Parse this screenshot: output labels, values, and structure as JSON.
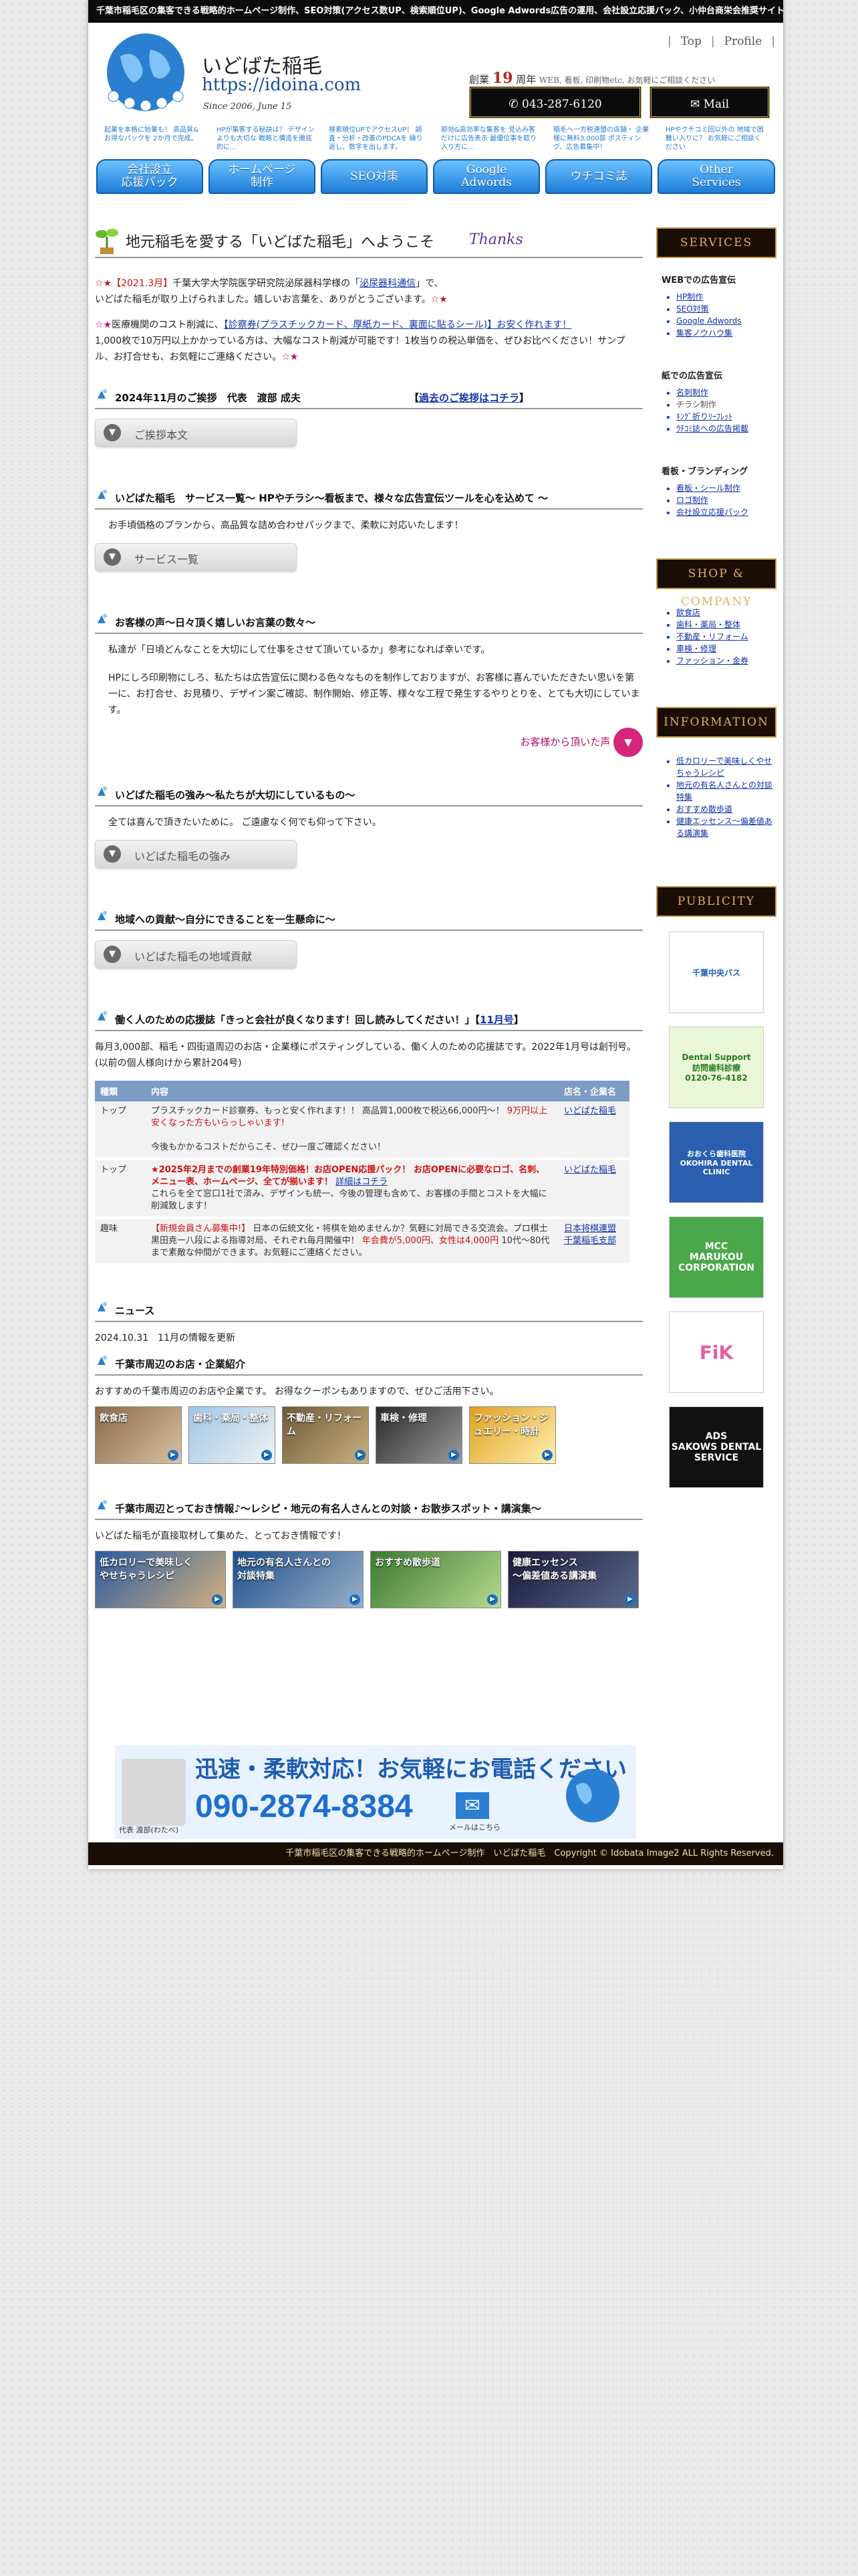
{
  "topbar": {
    "text": "千葉市稲毛区の集客できる戦略的ホームページ制作、SEO対策(アクセス数UP、検索順位UP)、Google Adwords広告の運用、会社設立応援パック、小仲台商栄会推奨サイト いどばた稲毛"
  },
  "header": {
    "brand_name": "いどばた稲毛",
    "brand_url": "https://idoina.com",
    "since": "Since 2006, June 15",
    "nav_links": [
      "Top",
      "Profile"
    ],
    "anniv_prefix": "創業",
    "anniv_years": "19",
    "anniv_suffix": "周年",
    "anniv_note": "WEB, 看板, 印刷物etc, お気軽にご相談ください",
    "tel": "043-287-6120",
    "mail": "Mail"
  },
  "teasers": [
    "起業を本格に始業も！ 高品質&お得なパックを 2か月で完成。",
    "HPが集客する秘訣は？ デザインよりも大切な 戦略と構造を徹底的に…",
    "検索順位UPでアクセスUP！ 調査・分析・改善のPDCAを 繰り返し、数字を出します。",
    "即効&高効率な集客を 見込み客だけに広告表示 最優位事を取り入り方に…",
    "稲毛へ一方税連盟の店舗・ 企業様に無料3,000部 ポスティング、広告募集中！",
    "HPやクチコミ回以外の 地域で困難い入りに？ お気軽にご相談ください"
  ],
  "nav_tabs": [
    "会社設立\n応援パック",
    "ホームページ\n制作",
    "SEO対策",
    "Google\nAdwords",
    "ウチコミ誌",
    "Other\nServices"
  ],
  "welcome": {
    "title": "地元稲毛を愛する「いどばた稲毛」へようこそ",
    "thanks": "Thanks",
    "line1_date": "【2021.3月】",
    "line1_text_a": "千葉大学大学院医学研究院泌尿器科学様の「",
    "line1_link": "泌尿器科通信",
    "line1_text_b": "」で、",
    "line2": "いどばた稲毛が取り上げられました。嬉しいお言葉を、ありがとうございます。",
    "line3_a": "医療機関のコスト削減に、",
    "line3_link": "【診察券(プラスチックカード、厚紙カード、裏面に貼るシール)】お安く作れます！",
    "line4": "1,000枚で10万円以上かかっている方は、大幅なコスト削減が可能です！1枚当りの税込単価を、ぜひお比べください！サンプル、お打合せも、お気軽にご連絡ください。"
  },
  "greeting": {
    "title": "2024年11月のご挨拶　代表　渡部 成夫",
    "link_pre": "【",
    "link": "過去のご挨拶はコチラ",
    "link_post": "】",
    "button": "ご挨拶本文"
  },
  "services": {
    "title": "いどばた稲毛　サービス一覧～ HPやチラシ～看板まで、様々な広告宣伝ツールを心を込めて ～",
    "desc": "お手頃価格のプランから、高品質な詰め合わせパックまで、柔軟に対応いたします！",
    "button": "サービス一覧"
  },
  "voices": {
    "title": "お客様の声～日々頂く嬉しいお言葉の数々～",
    "p1": "私達が「日頃どんなことを大切にして仕事をさせて頂いているか」参考になれば幸いです。",
    "p2": "HPにしろ印刷物にしろ、私たちは広告宣伝に関わる色々なものを制作しておりますが、お客様に喜んでいただきたい思いを第一に、お打合せ、お見積り、デザイン案ご確認、制作開始、修正等、様々な工程で発生するやりとりを、とても大切にしています。",
    "more": "お客様から頂いた声"
  },
  "strengths": {
    "title": "いどばた稲毛の強み～私たちが大切にしているもの～",
    "desc": "全ては喜んで頂きたいために。 ご遠慮なく何でも仰って下さい。",
    "button": "いどばた稲毛の強み"
  },
  "contribution": {
    "title": "地域への貢献～自分にできることを一生懸命に～",
    "button": "いどばた稲毛の地域貢献"
  },
  "support_mag": {
    "title": "働く人のための応援誌「きっと会社が良くなります！回し読みしてください！」【",
    "link": "11月号",
    "title_end": "】",
    "desc": "毎月3,000部、稲毛・四街道周辺のお店・企業様にポスティングしている、働く人のための応援誌です。2022年1月号は創刊号。(以前の個人様向けから累計204号)",
    "columns": [
      "種類",
      "内容",
      "店名・企業名"
    ],
    "rows": [
      {
        "kind": "トップ",
        "content_a": "プラスチックカード診察券、もっと安く作れます！！ 高品質1,000枚で税込66,000円～！",
        "content_red": "9万円以上安くなった方もいらっしゃいます!",
        "content_b": "今後もかかるコストだからこそ、ぜひ一度ご確認ください！",
        "shop": "いどばた稲毛"
      },
      {
        "kind": "トップ",
        "content_red": "★2025年2月までの創業19年特別価格！お店OPEN応援パック！ お店OPENに必要なロゴ、名刺、メニュー表、ホームページ、全てが揃います！",
        "content_link": "詳細はコチラ",
        "content_b": "これらを全て窓口1社で済み、デザインも統一、今後の管理も含めて、お客様の手間とコストを大幅に削減致します！",
        "shop": "いどばた稲毛"
      },
      {
        "kind": "趣味",
        "content_red": "【新規会員さん募集中!】",
        "content_a": "日本の伝統文化・将棋を始めませんか？気軽に対局できる交流会。プロ棋士黒田尭ー八段による指導対局、それぞれ毎月開催中！",
        "content_red2": "年会費が5,000円、女性は4,000円",
        "content_b": "10代～80代まで素敵な仲間ができます。お気軽にご連絡ください。",
        "shop": "日本将棋連盟 千葉稲毛支部"
      }
    ]
  },
  "news": {
    "title": "ニュース",
    "item": "2024.10.31　11月の情報を更新"
  },
  "local_shops": {
    "title": "千葉市周辺のお店・企業紹介",
    "desc": "おすすめの千葉市周辺のお店や企業です。 お得なクーポンもありますので、ぜひご活用下さい。",
    "thumbs": [
      "飲食店",
      "歯科・薬局・整体",
      "不動産・リフォーム",
      "車検・修理",
      "ファッション・ジュエリー・時計"
    ]
  },
  "local_info": {
    "title": "千葉市周辺とっておき情報♪～レシピ・地元の有名人さんとの対談・お散歩スポット・講演集～",
    "desc": "いどばた稲毛が直接取材して集めた、とっておき情報です！",
    "thumbs": [
      "低カロリーで美味しく\nやせちゃうレシピ",
      "地元の有名人さんとの\n対談特集",
      "おすすめ散歩道",
      "健康エッセンス\n～偏差値ある講演集"
    ]
  },
  "callbar": {
    "headline": "迅速・柔軟対応！お気軽にお電話ください",
    "phone": "090-2874-8384",
    "person": "代表 渡部(わたべ)",
    "mail_label": "メールはこちら"
  },
  "sidebar": {
    "services_head": "SERVICES",
    "web_sub": "WEBでの広告宣伝",
    "web_items": [
      "HP制作",
      "SEO対策",
      "Google Adwords",
      "集客ノウハウ集"
    ],
    "paper_sub": "紙での広告宣伝",
    "paper_items": [
      "名刺制作",
      "チラシ制作",
      "ｷﾝｸﾞ折りﾘｰﾌﾚｯﾄ",
      "ｳﾁｺﾐ誌への広告掲載"
    ],
    "sign_sub": "看板・ブランディング",
    "sign_items": [
      "看板・シール制作",
      "ロゴ制作",
      "会社設立応援パック"
    ],
    "shop_head": "SHOP & COMPANY",
    "shop_items": [
      "飲食店",
      "歯科・薬局・整体",
      "不動産・リフォーム",
      "車検・修理",
      "ファッション・金券"
    ],
    "info_head": "INFORMATION",
    "info_items": [
      "低カロリーで美味しくやせちゃうレシピ",
      "地元の有名人さんとの対談特集",
      "おすすめ散歩道",
      "健康エッセンス～偏差値ある講演集"
    ],
    "pub_head": "PUBLICITY",
    "banners": [
      "千葉中央バス",
      "Dental Support\n訪問歯科診療\n0120-76-4182",
      "おおくら歯科医院\nOKOHIRA DENTAL CLINIC",
      "MCC\nMARUKOU CORPORATION",
      "FiK",
      "ADS\nSAKOWS DENTAL SERVICE"
    ]
  },
  "footer": {
    "text": "千葉市稲毛区の集客できる戦略的ホームページ制作　いどばた稲毛　Copyright © Idobata Image2 ALL Rights Reserved."
  },
  "colors": {
    "accent_blue": "#1d7cd8",
    "dark": "#1a0d04",
    "gold": "#c59a4a",
    "link": "#1133aa"
  }
}
